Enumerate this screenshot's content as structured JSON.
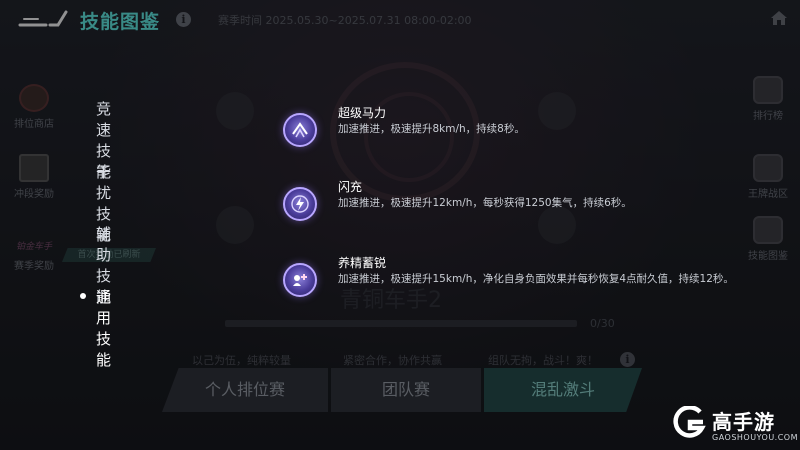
{
  "header": {
    "title": "技能图鉴",
    "season_time": "赛季时间 2025.05.30~2025.07.31 08:00-02:00"
  },
  "side_left": {
    "items": [
      {
        "label": "排位商店",
        "icon": "shop-icon"
      },
      {
        "label": "冲段奖励",
        "icon": "chest-icon"
      },
      {
        "label": "赛季奖励",
        "icon": "season-logo"
      }
    ],
    "logo_text": "铂金车手",
    "reward_badge": "首次奖励已刷新"
  },
  "side_right": {
    "items": [
      {
        "label": "排行榜",
        "icon": "trophy-icon"
      },
      {
        "label": "王牌战区",
        "icon": "car-icon"
      },
      {
        "label": "技能图鉴",
        "icon": "cards-icon"
      }
    ]
  },
  "rank": {
    "name": "青铜车手2",
    "progress": "0/30",
    "progress_fraction": 0
  },
  "modes": {
    "descriptions": [
      "以己为伍，纯粹较量",
      "紧密合作，协作共赢",
      "组队无拘，战斗！爽！"
    ],
    "tabs": [
      "个人排位赛",
      "团队赛",
      "混乱激斗"
    ],
    "active_tab": 2
  },
  "categories": [
    {
      "label": "竞速技能",
      "active": false
    },
    {
      "label": "干扰技能",
      "active": false
    },
    {
      "label": "辅助技能",
      "active": false
    },
    {
      "label": "通用技能",
      "active": true
    }
  ],
  "skills": [
    {
      "name": "超级马力",
      "desc": "加速推进，极速提升8km/h，持续8秒。",
      "icon": "speed-burst-icon"
    },
    {
      "name": "闪充",
      "desc": "加速推进，极速提升12km/h，每秒获得1250集气，持续6秒。",
      "icon": "lightning-charge-icon"
    },
    {
      "name": "养精蓄锐",
      "desc": "加速推进，极速提升15km/h，净化自身负面效果并每秒恢复4点耐久值，持续12秒。",
      "icon": "heal-icon"
    }
  ],
  "watermark": {
    "brand": "高手游",
    "domain": "GAOSHOUYOU.COM"
  },
  "colors": {
    "title_accent": "#5ff2ea",
    "active_tab": "#1f4a47",
    "skill_icon": "#6a5cc8"
  }
}
